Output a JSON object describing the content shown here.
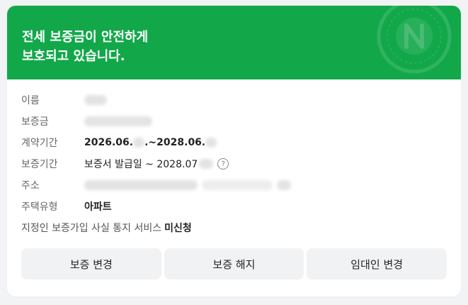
{
  "header": {
    "title_line1": "전세 보증금이 안전하게",
    "title_line2": "보호되고 있습니다.",
    "bg_color": "#12a84a",
    "emblem_icon": "guarantee-seal-icon"
  },
  "info": {
    "name": {
      "label": "이름"
    },
    "deposit": {
      "label": "보증금"
    },
    "contract_period": {
      "label": "계약기간",
      "start_prefix": "2026.06.",
      "separator": ".~",
      "end_prefix": "2028.06."
    },
    "guarantee_period": {
      "label": "보증기간",
      "value_prefix": "보증서 발급일 ~ 2028.07",
      "help_icon": "question-circle-icon"
    },
    "address": {
      "label": "주소"
    },
    "housing_type": {
      "label": "주택유형",
      "value": "아파트"
    }
  },
  "notice": {
    "text": "지정인 보증가입 사실 통지 서비스",
    "status": "미신청"
  },
  "buttons": {
    "change_guarantee": "보증 변경",
    "cancel_guarantee": "보증 해지",
    "change_landlord": "임대인 변경"
  }
}
